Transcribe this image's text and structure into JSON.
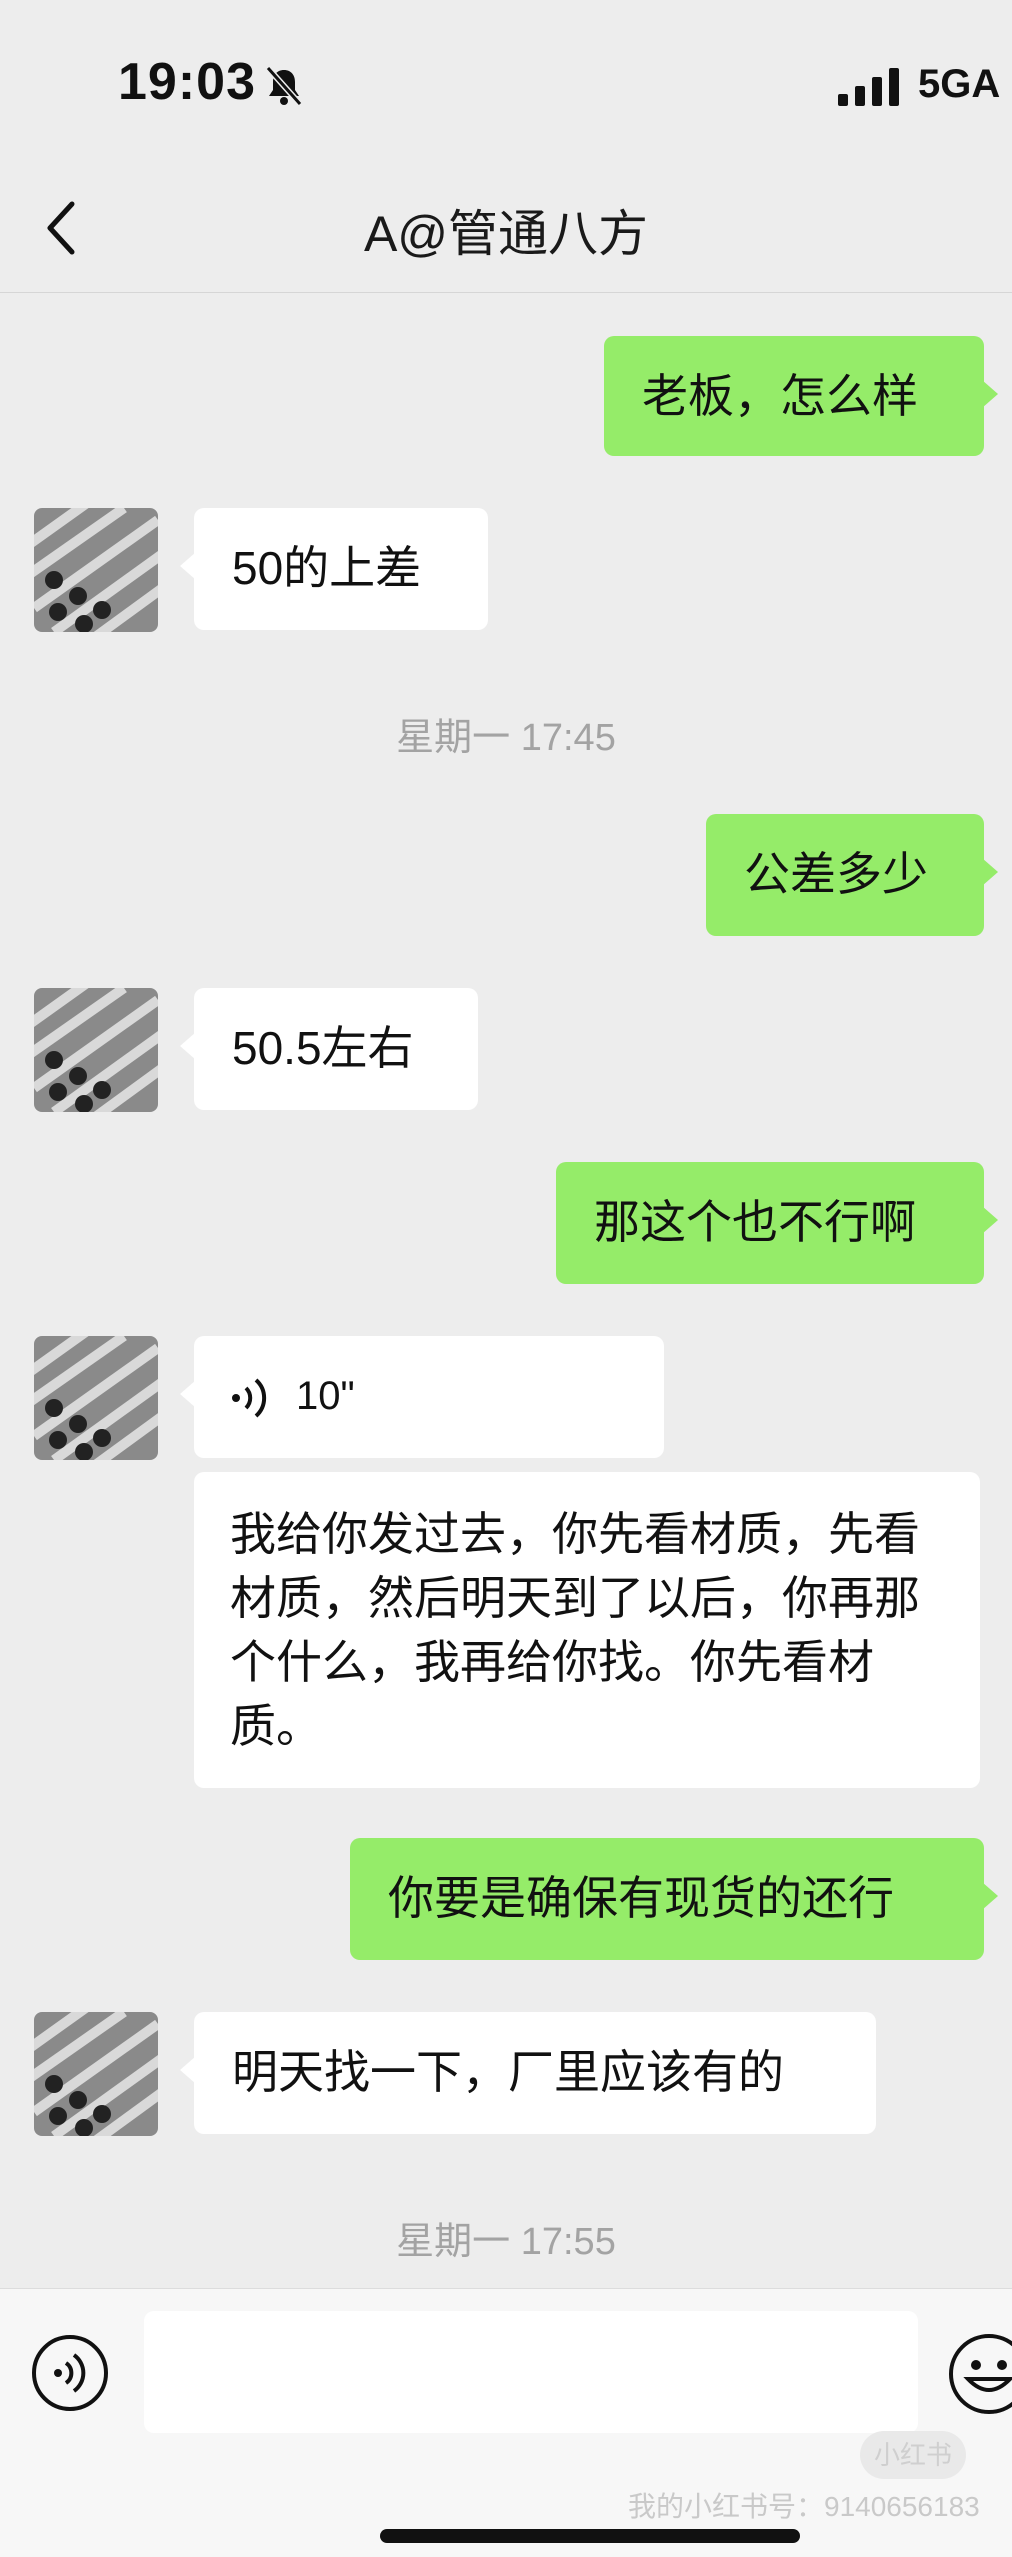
{
  "status": {
    "time": "19:03",
    "network": "5GA"
  },
  "nav": {
    "title": "A@管通八方"
  },
  "messages": {
    "m1": "老板，怎么样",
    "m2": "50的上差",
    "t1": "星期一 17:45",
    "m3": "公差多少",
    "m4": "50.5左右",
    "m5": "那这个也不行啊",
    "voice_duration": "10\"",
    "m6": "我给你发过去，你先看材质，先看材质，然后明天到了以后，你再那个什么，我再给你找。你先看材质。",
    "m7": "你要是确保有现货的还行",
    "m8": "明天找一下，厂里应该有的",
    "t2": "星期一 17:55"
  },
  "input": {
    "placeholder": ""
  },
  "watermark": {
    "badge": "小红书",
    "text": "我的小红书号：9140656183"
  },
  "colors": {
    "my_bubble": "#95ec69",
    "their_bubble": "#ffffff",
    "background": "#ededed"
  }
}
